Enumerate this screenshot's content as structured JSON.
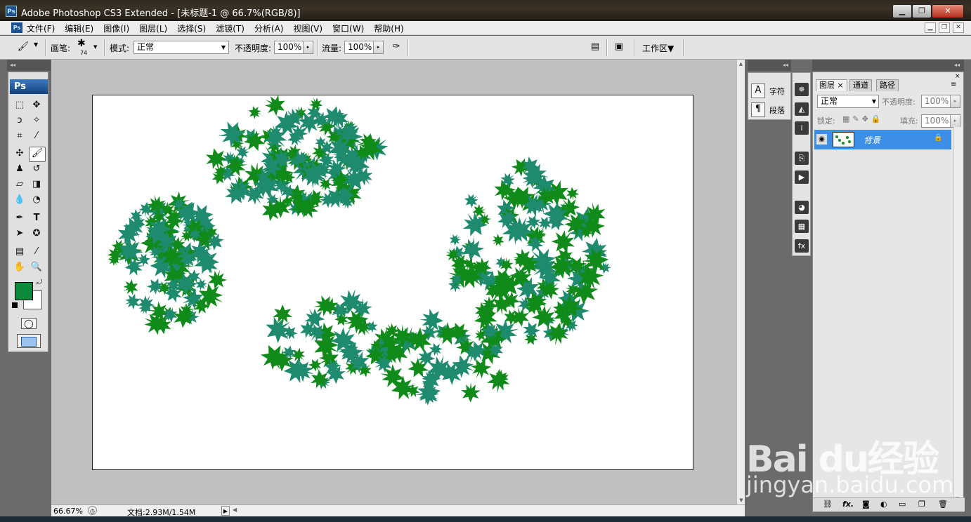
{
  "window": {
    "app_icon": "Ps",
    "title": "Adobe Photoshop CS3 Extended - [未标题-1 @ 66.7%(RGB/8)]",
    "buttons": {
      "minimize": "▁",
      "restore": "❐",
      "close": "✕"
    }
  },
  "menu": {
    "items": [
      "文件(F)",
      "编辑(E)",
      "图像(I)",
      "图层(L)",
      "选择(S)",
      "滤镜(T)",
      "分析(A)",
      "视图(V)",
      "窗口(W)",
      "帮助(H)"
    ],
    "doc_buttons": [
      "▁",
      "❐",
      "✕"
    ]
  },
  "options": {
    "brush_label": "画笔:",
    "brush_size": "74",
    "mode_label": "模式:",
    "mode_value": "正常",
    "opacity_label": "不透明度:",
    "opacity_value": "100%",
    "flow_label": "流量:",
    "flow_value": "100%",
    "workspace_label": "工作区▼"
  },
  "toolbox": {
    "logo": "Ps"
  },
  "colors": {
    "foreground": "#0b8a3c",
    "background": "#ffffff",
    "leaf_green": "#108b1a",
    "leaf_teal": "#1e8a6e",
    "selection": "#3c8ee6"
  },
  "status": {
    "zoom": "66.67%",
    "doc_info": "文档:2.93M/1.54M"
  },
  "char_panel": {
    "character_label": "字符",
    "paragraph_label": "段落"
  },
  "layers_panel": {
    "tabs": [
      "图层",
      "通道",
      "路径"
    ],
    "tab_close": "×",
    "blend_mode": "正常",
    "opacity_label": "不透明度:",
    "opacity_value": "100%",
    "lock_label": "锁定:",
    "fill_label": "填充:",
    "fill_value": "100%",
    "layers": [
      {
        "name": "背景",
        "visible": true,
        "locked": true
      }
    ],
    "footer_icons": [
      "link-icon",
      "fx-icon",
      "mask-icon",
      "adjustment-icon",
      "group-icon",
      "new-layer-icon",
      "trash-icon"
    ]
  },
  "watermark": {
    "brand": "Bai  du经验",
    "url": "jingyan.baidu.com"
  }
}
